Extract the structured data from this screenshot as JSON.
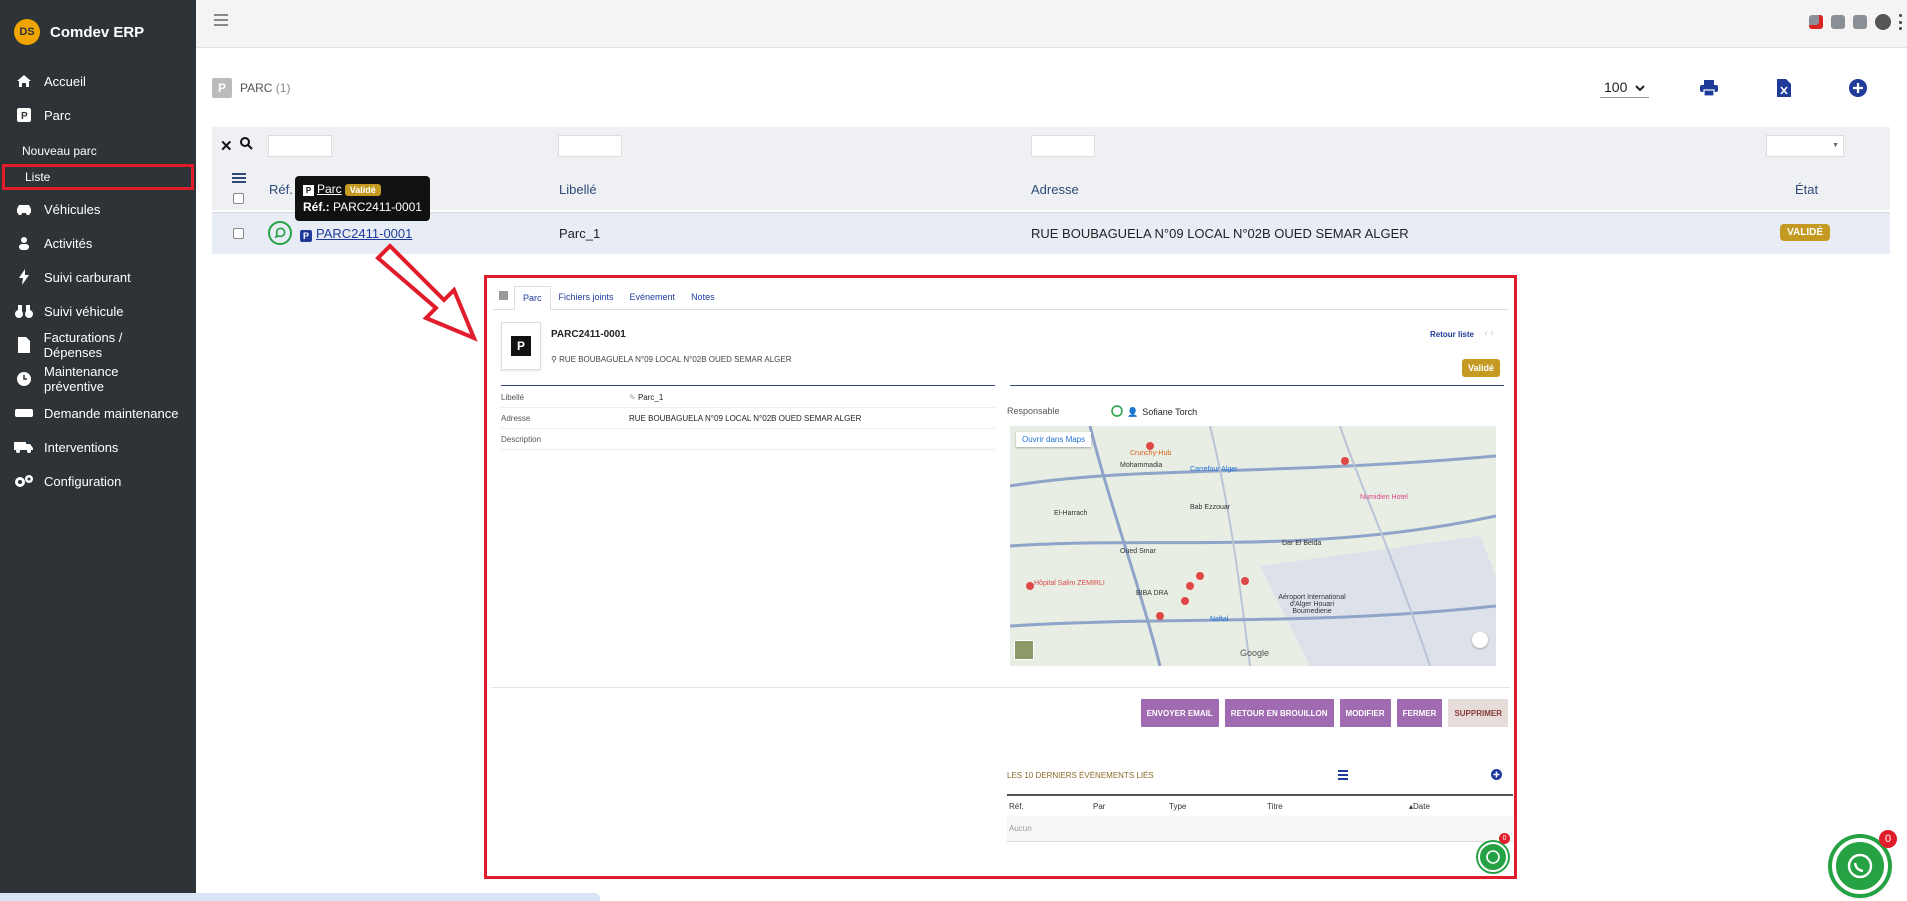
{
  "app": {
    "title": "Comdev ERP"
  },
  "sidebar": {
    "items": [
      {
        "label": "Accueil",
        "icon": "home-icon"
      },
      {
        "label": "Parc",
        "icon": "parking-icon"
      },
      {
        "label": "Véhicules",
        "icon": "car-icon"
      },
      {
        "label": "Activités",
        "icon": "people-icon"
      },
      {
        "label": "Suivi carburant",
        "icon": "bolt-icon"
      },
      {
        "label": "Suivi véhicule",
        "icon": "binoculars-icon"
      },
      {
        "label": "Facturations / Dépenses",
        "icon": "document-icon"
      },
      {
        "label": "Maintenance préventive",
        "icon": "clock-icon"
      },
      {
        "label": "Demande maintenance",
        "icon": "drive-icon"
      },
      {
        "label": "Interventions",
        "icon": "truck-icon"
      },
      {
        "label": "Configuration",
        "icon": "gears-icon"
      }
    ],
    "sub_items": [
      {
        "label": "Nouveau parc"
      },
      {
        "label": "Liste",
        "active": true
      }
    ]
  },
  "page": {
    "title": "PARC",
    "count": "(1)",
    "page_size": "100"
  },
  "table": {
    "headers": {
      "ref": "Réf.",
      "libelle": "Libellé",
      "adresse": "Adresse",
      "etat": "État"
    },
    "rows": [
      {
        "ref": "PARC2411-0001",
        "libelle": "Parc_1",
        "adresse": "RUE BOUBAGUELA N°09 LOCAL N°02B OUED SEMAR ALGER",
        "etat": "VALIDÉ"
      }
    ]
  },
  "tooltip": {
    "title": "Parc",
    "badge": "Validé",
    "ref_label": "Réf.:",
    "ref_value": "PARC2411-0001"
  },
  "preview": {
    "tabs": [
      "Parc",
      "Fichiers joints",
      "Evénement",
      "Notes"
    ],
    "ref": "PARC2411-0001",
    "address": "RUE BOUBAGUELA N°09 LOCAL N°02B OUED SEMAR ALGER",
    "retour": "Retour liste",
    "status": "Validé",
    "fields": [
      {
        "key": "Libellé",
        "value": "Parc_1"
      },
      {
        "key": "Adresse",
        "value": "RUE BOUBAGUELA N°09 LOCAL N°02B OUED SEMAR ALGER"
      },
      {
        "key": "Description",
        "value": ""
      }
    ],
    "responsable_label": "Responsable",
    "responsable_value": "Sofiane Torch",
    "map_button": "Ouvrir dans Maps",
    "map_labels": [
      "Mohammadia",
      "Carrefour Alger",
      "Bab Ezzouar",
      "El-Harrach",
      "Dar El Beida",
      "Oued Smar",
      "Aéroport International d'Alger Houari Boumediene",
      "Numidien Hotel",
      "Crunchy-Hub",
      "BIBA DRA",
      "Naftal",
      "Hôpital Salim ZEMIRLI",
      "Google"
    ],
    "buttons": [
      "ENVOYER EMAIL",
      "RETOUR EN BROUILLON",
      "MODIFIER",
      "FERMER",
      "SUPPRIMER"
    ],
    "events_title": "LES 10 DERNIERS ÉVÉNEMENTS LIÉS",
    "events_headers": [
      "Réf.",
      "Par",
      "Type",
      "Titre",
      "Date"
    ],
    "events_empty": "Aucun",
    "wa_badge": "0"
  },
  "floating": {
    "badge": "0"
  },
  "colors": {
    "sidebar": "#2e3338",
    "accent": "#1f3b9a",
    "badge": "#c49a22",
    "highlight": "#e21d2b",
    "action": "#a06bb0",
    "whatsapp": "#25a244"
  }
}
